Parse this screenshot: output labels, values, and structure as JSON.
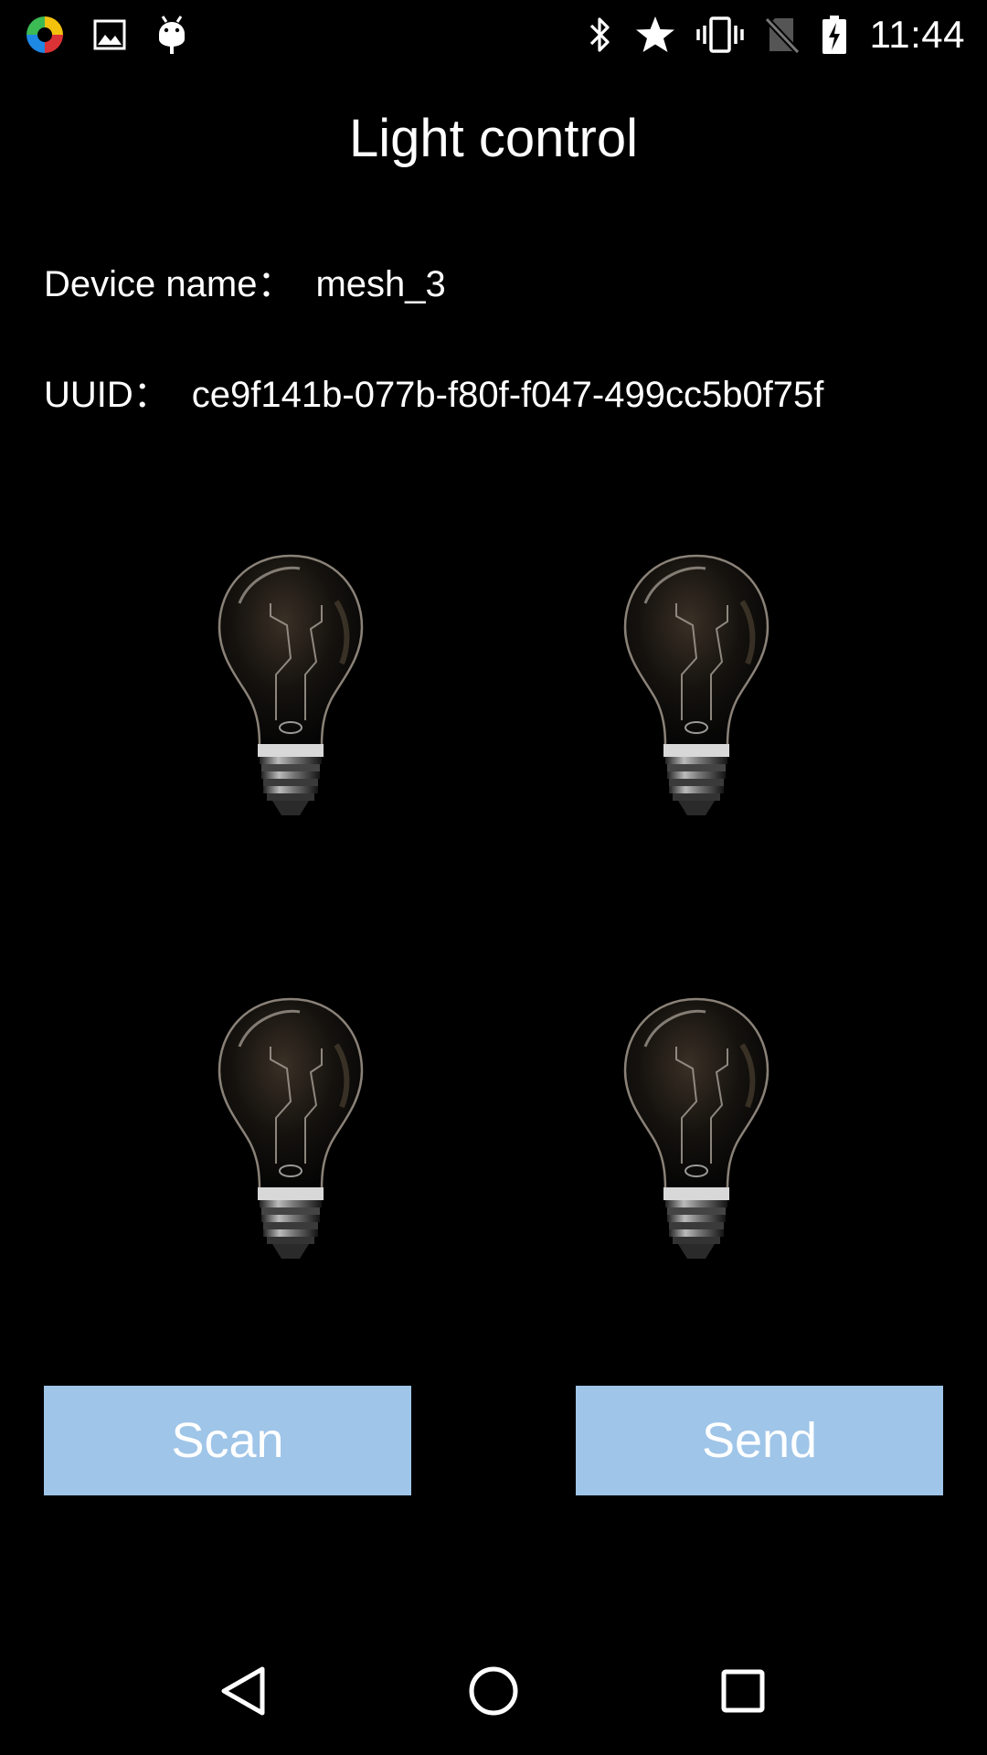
{
  "status_bar": {
    "time": "11:44",
    "left_icons": [
      "colorful-app-icon",
      "image-icon",
      "android-debug-icon"
    ],
    "right_icons": [
      "bluetooth-icon",
      "star-icon",
      "vibrate-icon",
      "no-sim-icon",
      "battery-charging-icon"
    ]
  },
  "header": {
    "title": "Light control"
  },
  "device": {
    "name_label": "Device name：",
    "name_value": "mesh_3",
    "uuid_label": "UUID：",
    "uuid_value": "ce9f141b-077b-f80f-f047-499cc5b0f75f"
  },
  "lights": [
    {
      "icon": "light-bulb-icon",
      "state": "off"
    },
    {
      "icon": "light-bulb-icon",
      "state": "off"
    },
    {
      "icon": "light-bulb-icon",
      "state": "off"
    },
    {
      "icon": "light-bulb-icon",
      "state": "off"
    }
  ],
  "buttons": {
    "scan_label": "Scan",
    "send_label": "Send",
    "color": "#9fc5e8"
  },
  "nav": {
    "icons": [
      "back-icon",
      "home-icon",
      "recents-icon"
    ]
  }
}
